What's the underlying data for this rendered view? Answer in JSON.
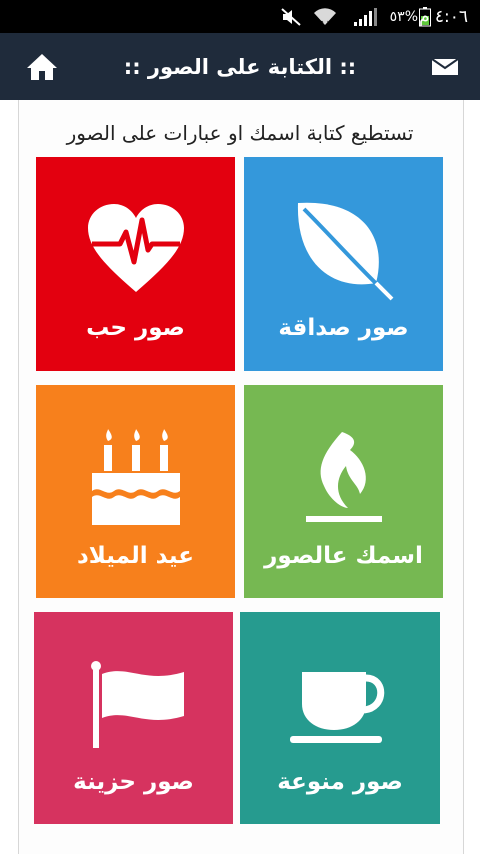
{
  "status_bar": {
    "time": "٤:٠٦ م",
    "battery_percent": "٥٣%",
    "icons": [
      "mute-icon",
      "wifi-icon",
      "signal-icon",
      "battery-icon"
    ]
  },
  "app_bar": {
    "title": ":: الكتابة على الصور ::",
    "home_icon": "home-icon",
    "mail_icon": "mail-icon"
  },
  "subtitle": "تستطيع كتابة اسمك او عبارات على الصور",
  "tiles": [
    {
      "label": "صور صداقة",
      "icon": "leaf-icon",
      "color": "#3498db"
    },
    {
      "label": "صور حب",
      "icon": "heart-pulse-icon",
      "color": "#e3000f"
    },
    {
      "label": "اسمك عالصور",
      "icon": "flame-icon",
      "color": "#76b852"
    },
    {
      "label": "عيد الميلاد",
      "icon": "birthday-cake-icon",
      "color": "#f7801c"
    },
    {
      "label": "صور منوعة",
      "icon": "coffee-cup-icon",
      "color": "#269b8f"
    },
    {
      "label": "صور حزينة",
      "icon": "flag-icon",
      "color": "#d6335f"
    }
  ]
}
